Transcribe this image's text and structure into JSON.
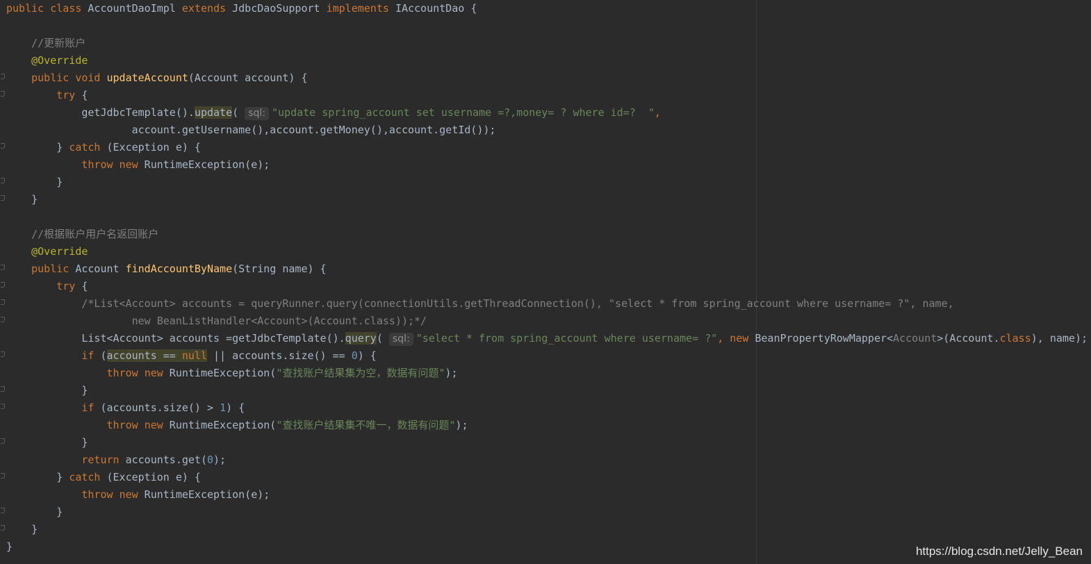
{
  "code": {
    "l1": [
      "public",
      "class",
      "AccountDaoImpl",
      "extends",
      "JdbcDaoSupport",
      "implements",
      "IAccountDao",
      "{"
    ],
    "comment_update": "//更新账户",
    "override": "@Override",
    "l_update_sig": [
      "public",
      "void",
      "updateAccount",
      "(Account account) {"
    ],
    "try": "try",
    "brace_open": " {",
    "getjdbc": "getJdbcTemplate().",
    "update": "update",
    "paren_open": "(",
    "sql_hint": "sql:",
    "update_sql": "\"update spring_account set username =?,money= ? where id=?  \"",
    "comma": ",",
    "update_args": "account.getUsername(),account.getMoney(),account.getId());",
    "catch_pre": "} ",
    "catch": "catch",
    "catch_post": " (Exception e) {",
    "throw": "throw",
    "new": "new",
    "rte_e": " RuntimeException(e);",
    "close_brace": "}",
    "comment_find": "//根据账户用户名返回账户",
    "l_find_sig": [
      "public",
      "Account",
      "findAccountByName",
      "(String name) {"
    ],
    "cm_block1": "/*List<Account> accounts = queryRunner.query(connectionUtils.getThreadConnection(), \"select * from spring_account where username= ?\", name,",
    "cm_block2": "new BeanListHandler<Account>(Account.class));*/",
    "list_pre": "List<Account> accounts =getJdbcTemplate().",
    "query": "query",
    "select_sql": "\"select * from spring_account where username= ?\"",
    "bprm": "BeanPropertyRowMapper",
    "gen_account": "Account",
    "account_class": "(Account.",
    "class_kw": "class",
    "name_end": "), name);",
    "if": "if",
    "if1_hl": "accounts == ",
    "null": "null",
    "if1_rest": " || accounts.size() == ",
    "zero": "0",
    "if_close": ") {",
    "rte_msg1": "\"查找账户结果集为空，数据有问题\"",
    "if2_pre": " (accounts.size() > ",
    "one": "1",
    "rte_msg2": "\"查找账户结果集不唯一，数据有问题\"",
    "return": "return",
    "ret_rest": " accounts.get(",
    "ret_end": ");",
    "rte_open": " RuntimeException(",
    "rte_close": ");"
  },
  "watermark": "https://blog.csdn.net/Jelly_Bean",
  "colors": {
    "background": "#2b2b2b",
    "keyword": "#cc7832",
    "method": "#ffc66d",
    "annotation": "#bbb529",
    "string": "#6a8759",
    "comment": "#808080",
    "number": "#6897bb",
    "text": "#a9b7c6"
  }
}
